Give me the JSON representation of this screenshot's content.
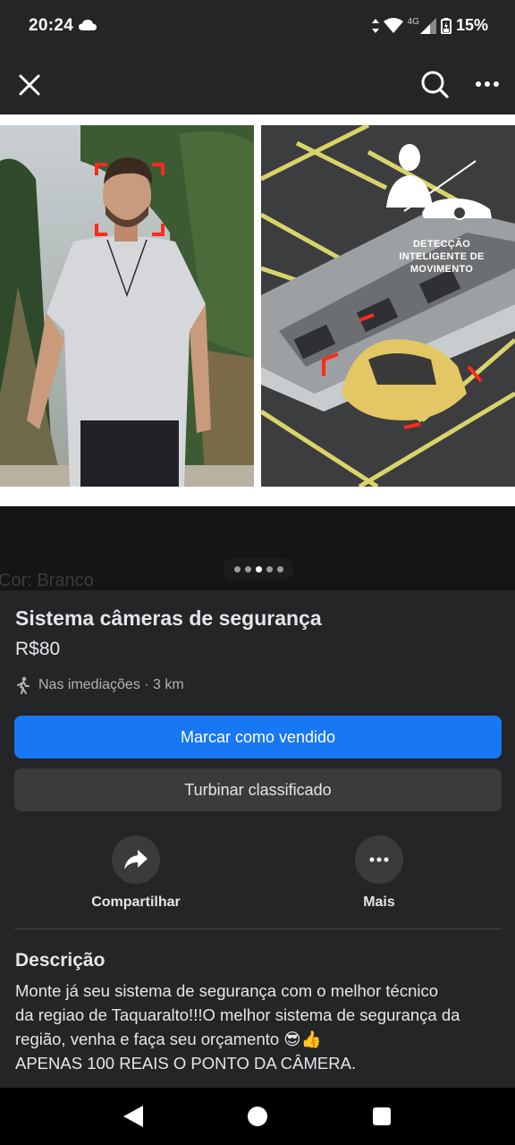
{
  "status_bar": {
    "time": "20:24",
    "network": "4G",
    "battery": "15%",
    "icons": [
      "cloud-icon",
      "data-arrows-icon",
      "wifi-icon",
      "signal-icon",
      "battery-icon"
    ]
  },
  "top_bar": {
    "icons": [
      "close-icon",
      "search-icon",
      "more-options-icon"
    ]
  },
  "gallery": {
    "caption_line1": "DETECÇÃO",
    "caption_line2": "INTELIGENTE DE",
    "caption_line3": "MOVIMENTO",
    "ghost_text": "Cor: Branco",
    "page_count": 5,
    "active_page": 3
  },
  "listing": {
    "title": "Sistema câmeras de segurança",
    "price": "R$80",
    "location": "Nas imediações · 3 km"
  },
  "buttons": {
    "mark_sold": "Marcar como vendido",
    "boost": "Turbinar classificado"
  },
  "actions": {
    "share": "Compartilhar",
    "more": "Mais"
  },
  "description": {
    "heading": "Descrição",
    "line1": "Monte já seu sistema de segurança com o melhor técnico",
    "line2": "da regiao de Taquaralto!!!O melhor sistema de segurança da",
    "line3": "região, venha e faça seu orçamento 😎👍",
    "line4": "APENAS 100 REAIS O PONTO DA CÂMERA."
  },
  "colors": {
    "background": "#242526",
    "primary_button": "#1877f2",
    "secondary_button": "#3a3b3c",
    "text_primary": "#e4e6eb",
    "text_secondary": "#b0b3b8",
    "detection_box": "#ff2a1a"
  }
}
